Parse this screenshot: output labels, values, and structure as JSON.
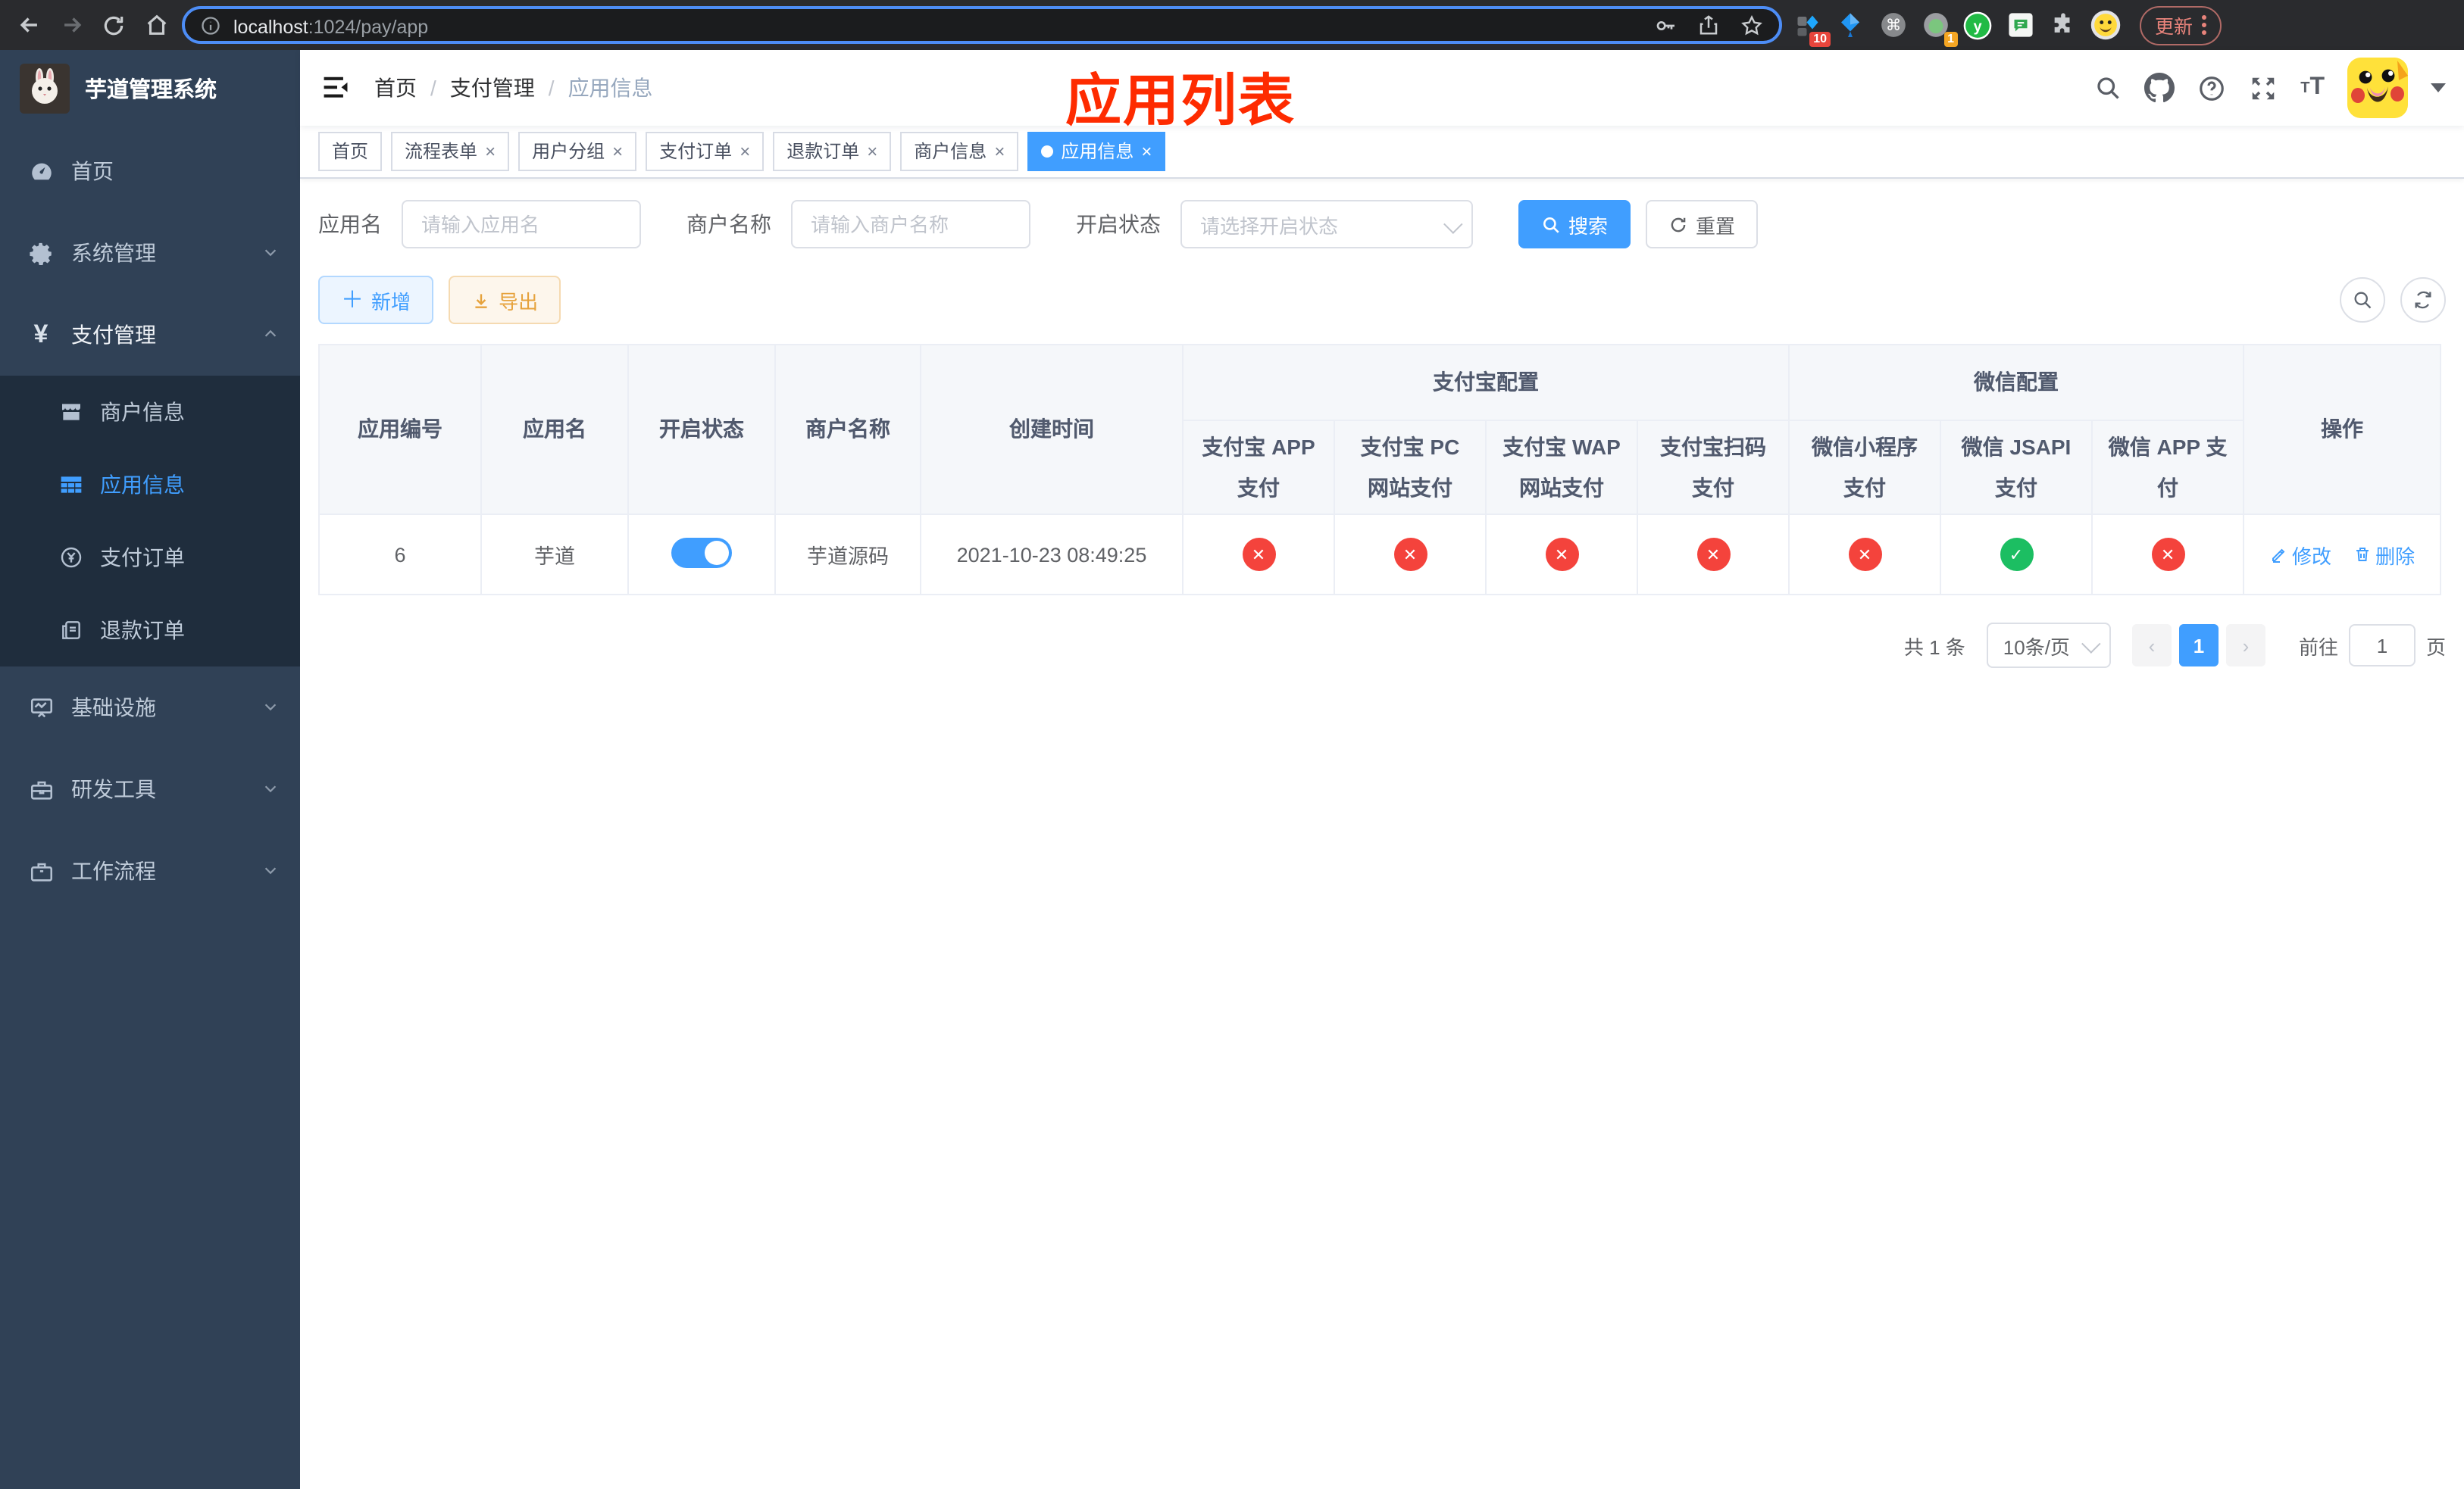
{
  "colors": {
    "accent": "#409EFF",
    "sidebar_bg": "#304156",
    "submenu_bg": "#1f2d3d",
    "danger": "#f4433c",
    "success": "#1cbe62",
    "annotation": "#fe2b00",
    "warning": "#e6a23c"
  },
  "browser": {
    "url_host": "localhost",
    "url_rest": ":1024/pay/app",
    "extension_badge_count": "10",
    "avatar_badge_count": "1",
    "y_extension_letter": "y",
    "update_button": "更新"
  },
  "sidebar": {
    "logo_title": "芋道管理系统",
    "items": [
      {
        "label": "首页",
        "icon": "dashboard-icon"
      },
      {
        "label": "系统管理",
        "icon": "gear-icon",
        "chevron": "down"
      },
      {
        "label": "支付管理",
        "icon": "yuan-icon",
        "chevron": "up"
      },
      {
        "label": "基础设施",
        "icon": "monitor-icon",
        "chevron": "down"
      },
      {
        "label": "研发工具",
        "icon": "toolbox-icon",
        "chevron": "down"
      },
      {
        "label": "工作流程",
        "icon": "briefcase-icon",
        "chevron": "down"
      }
    ],
    "submenu": [
      {
        "label": "商户信息",
        "icon": "shop-icon",
        "active": false
      },
      {
        "label": "应用信息",
        "icon": "grid-icon",
        "active": true
      },
      {
        "label": "支付订单",
        "icon": "coin-icon",
        "active": false
      },
      {
        "label": "退款订单",
        "icon": "document-icon",
        "active": false
      }
    ]
  },
  "header": {
    "breadcrumb": [
      "首页",
      "支付管理",
      "应用信息"
    ],
    "breadcrumb_separator": "/",
    "annotation_title": "应用列表"
  },
  "tabs": [
    {
      "label": "首页",
      "closable": false,
      "active": false
    },
    {
      "label": "流程表单",
      "closable": true,
      "active": false
    },
    {
      "label": "用户分组",
      "closable": true,
      "active": false
    },
    {
      "label": "支付订单",
      "closable": true,
      "active": false
    },
    {
      "label": "退款订单",
      "closable": true,
      "active": false
    },
    {
      "label": "商户信息",
      "closable": true,
      "active": false
    },
    {
      "label": "应用信息",
      "closable": true,
      "active": true
    }
  ],
  "tabs_close_glyph": "×",
  "search": {
    "app_name_label": "应用名",
    "app_name_placeholder": "请输入应用名",
    "merchant_label": "商户名称",
    "merchant_placeholder": "请输入商户名称",
    "status_label": "开启状态",
    "status_placeholder": "请选择开启状态",
    "search_button": "搜索",
    "reset_button": "重置"
  },
  "toolbar": {
    "add_button": "新增",
    "export_button": "导出"
  },
  "table": {
    "group_headers": {
      "alipay": "支付宝配置",
      "wechat": "微信配置"
    },
    "columns": [
      "应用编号",
      "应用名",
      "开启状态",
      "商户名称",
      "创建时间",
      "支付宝 APP 支付",
      "支付宝 PC 网站支付",
      "支付宝 WAP 网站支付",
      "支付宝扫码支付",
      "微信小程序支付",
      "微信 JSAPI 支付",
      "微信 APP 支付",
      "操作"
    ],
    "rows": [
      {
        "id": "6",
        "name": "芋道",
        "enabled": true,
        "merchant": "芋道源码",
        "created": "2021-10-23 08:49:25",
        "channels": [
          false,
          false,
          false,
          false,
          false,
          true,
          false
        ],
        "edit_label": "修改",
        "delete_label": "删除"
      }
    ]
  },
  "status_glyphs": {
    "on": "✓",
    "off": "✕"
  },
  "pagination": {
    "total": "共 1 条",
    "page_size": "10条/页",
    "prev_glyph": "‹",
    "next_glyph": "›",
    "current_page": "1",
    "goto_label": "前往",
    "goto_value": "1",
    "page_suffix": "页"
  }
}
